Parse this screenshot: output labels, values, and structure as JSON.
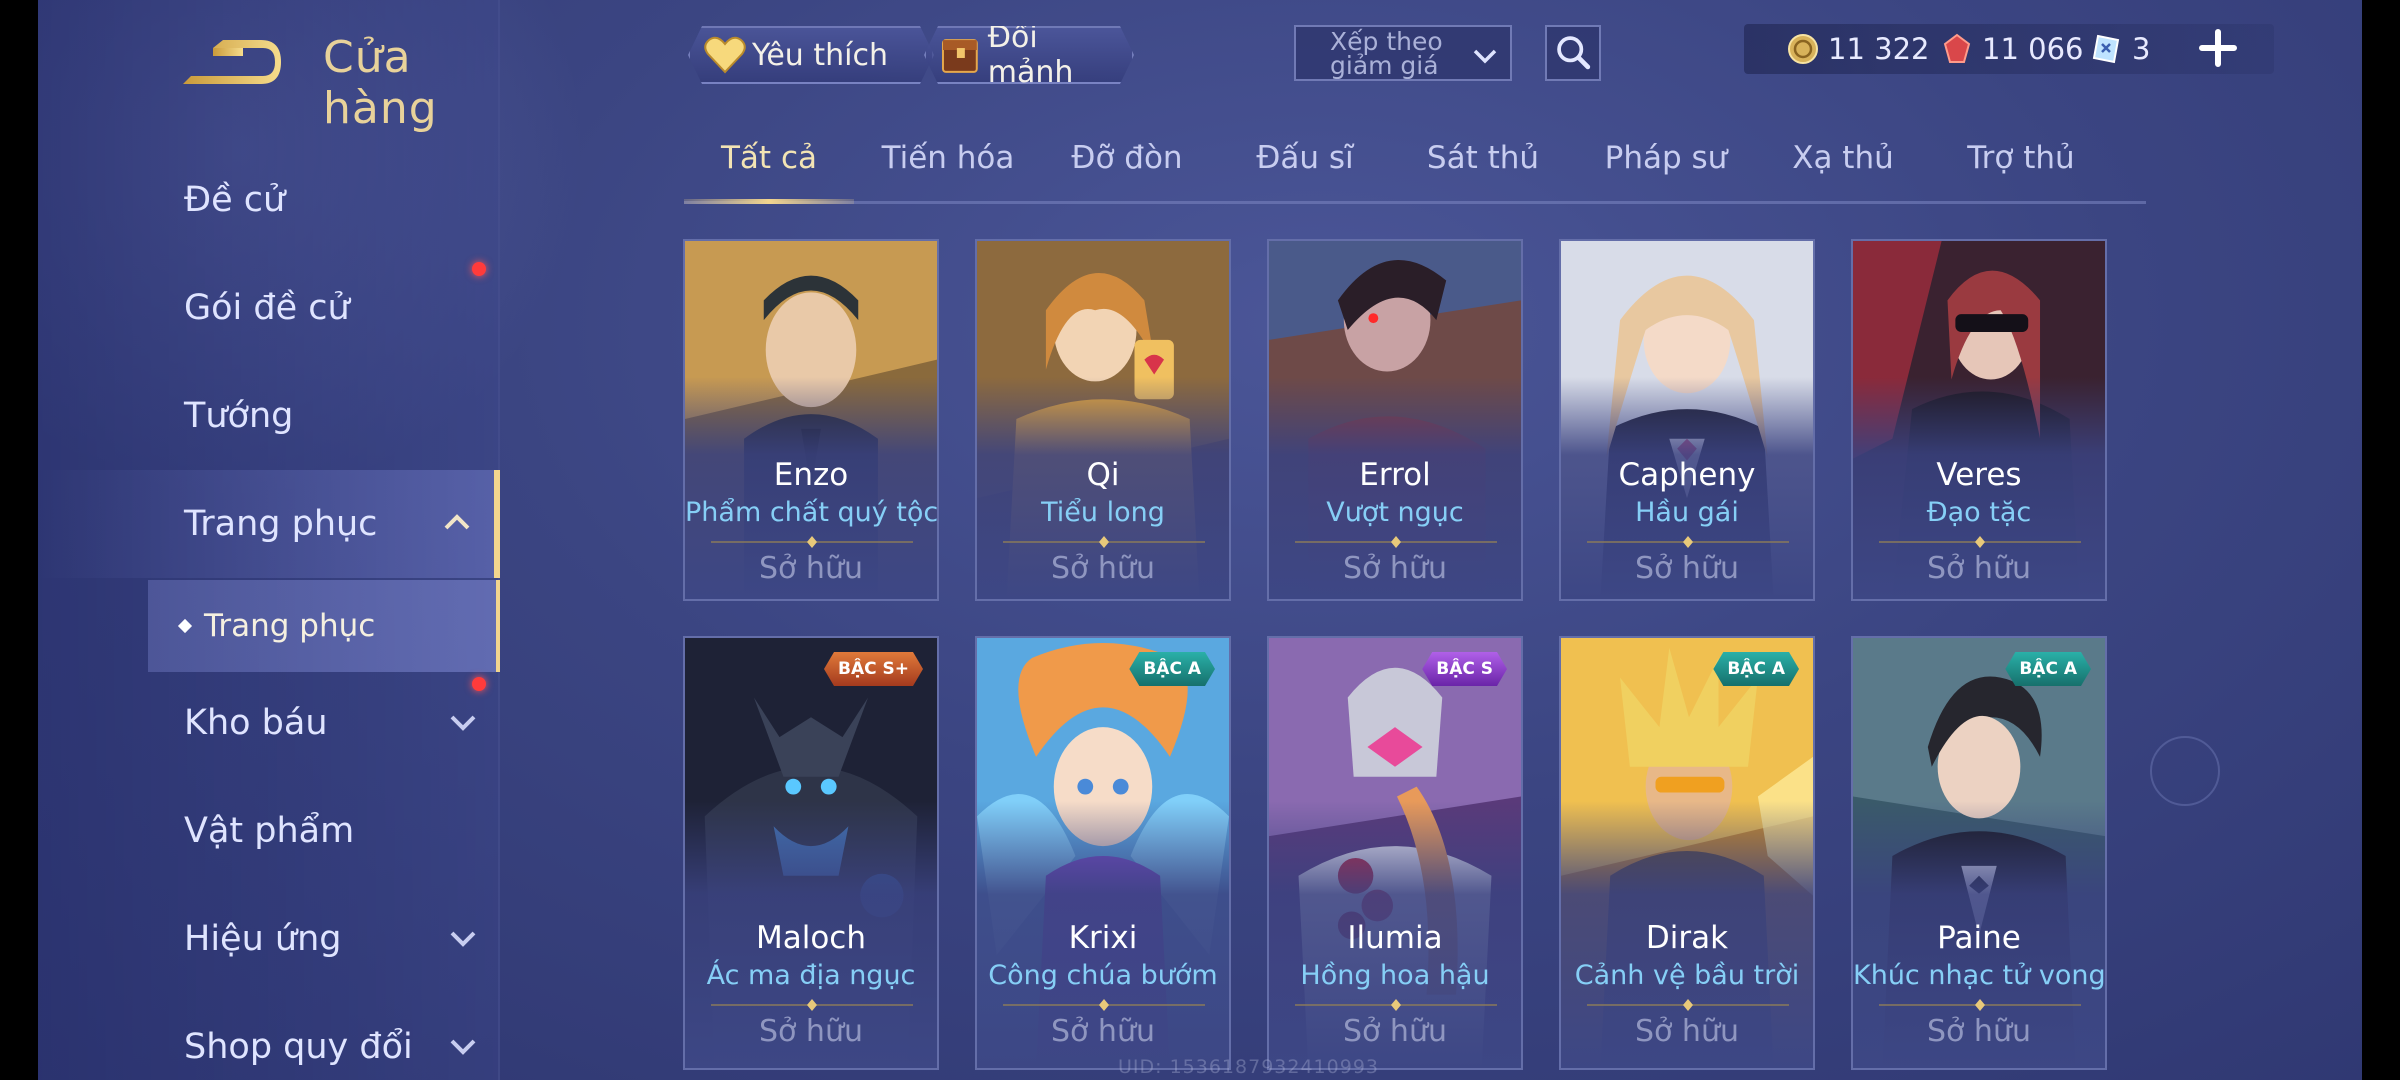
{
  "header": {
    "title": "Cửa hàng"
  },
  "toolbar": {
    "favorites_label": "Yêu thích",
    "exchange_label": "Đổi mảnh",
    "sort_label": "Xếp theo giảm giá",
    "sort_line1": "Xếp theo",
    "sort_line2": "giảm giá"
  },
  "currency": {
    "gold": "11 322",
    "ruby": "11 066",
    "vouchers": "3"
  },
  "sidebar": {
    "items": [
      {
        "label": "Đề cử"
      },
      {
        "label": "Gói đề cử"
      },
      {
        "label": "Tướng"
      },
      {
        "label": "Trang phục"
      },
      {
        "label": "Kho báu"
      },
      {
        "label": "Vật phẩm"
      },
      {
        "label": "Hiệu ứng"
      },
      {
        "label": "Shop quy đổi"
      }
    ],
    "sub_item": "Trang phục"
  },
  "tabs": [
    "Tất cả",
    "Tiến hóa",
    "Đỡ đòn",
    "Đấu sĩ",
    "Sát thủ",
    "Pháp sư",
    "Xạ thủ",
    "Trợ thủ"
  ],
  "cards": [
    {
      "hero": "Enzo",
      "skin": "Phẩm chất quý tộc",
      "status": "Sở hữu",
      "badge": ""
    },
    {
      "hero": "Qi",
      "skin": "Tiểu long",
      "status": "Sở hữu",
      "badge": ""
    },
    {
      "hero": "Errol",
      "skin": "Vượt ngục",
      "status": "Sở hữu",
      "badge": ""
    },
    {
      "hero": "Capheny",
      "skin": "Hầu gái",
      "status": "Sở hữu",
      "badge": ""
    },
    {
      "hero": "Veres",
      "skin": "Đạo tặc",
      "status": "Sở hữu",
      "badge": ""
    },
    {
      "hero": "Maloch",
      "skin": "Ác ma địa ngục",
      "status": "Sở hữu",
      "badge": "BẬC S+"
    },
    {
      "hero": "Krixi",
      "skin": "Công chúa bướm",
      "status": "Sở hữu",
      "badge": "BẬC A"
    },
    {
      "hero": "Ilumia",
      "skin": "Hồng hoa hậu",
      "status": "Sở hữu",
      "badge": "BẬC S"
    },
    {
      "hero": "Dirak",
      "skin": "Cảnh vệ bầu trời",
      "status": "Sở hữu",
      "badge": "BẬC A"
    },
    {
      "hero": "Paine",
      "skin": "Khúc nhạc tử vong",
      "status": "Sở hữu",
      "badge": "BẬC A"
    }
  ],
  "footer": {
    "uid": "UID: 1536187932410993"
  },
  "colors": {
    "accent_gold": "#f2d58e",
    "skin_name": "#86cff6",
    "owned_text": "#8f96c0",
    "badge_splus": "#c0542a",
    "badge_a": "#1a8f8c",
    "badge_s": "#8a3cc8"
  },
  "icons": {
    "back": "back-arrow-icon",
    "favorites": "heart-icon",
    "exchange": "shard-chest-icon",
    "sort": "chevron-down-icon",
    "search": "search-icon",
    "gold": "gold-coin-icon",
    "ruby": "ruby-gem-icon",
    "voucher": "voucher-icon",
    "add": "plus-icon"
  }
}
